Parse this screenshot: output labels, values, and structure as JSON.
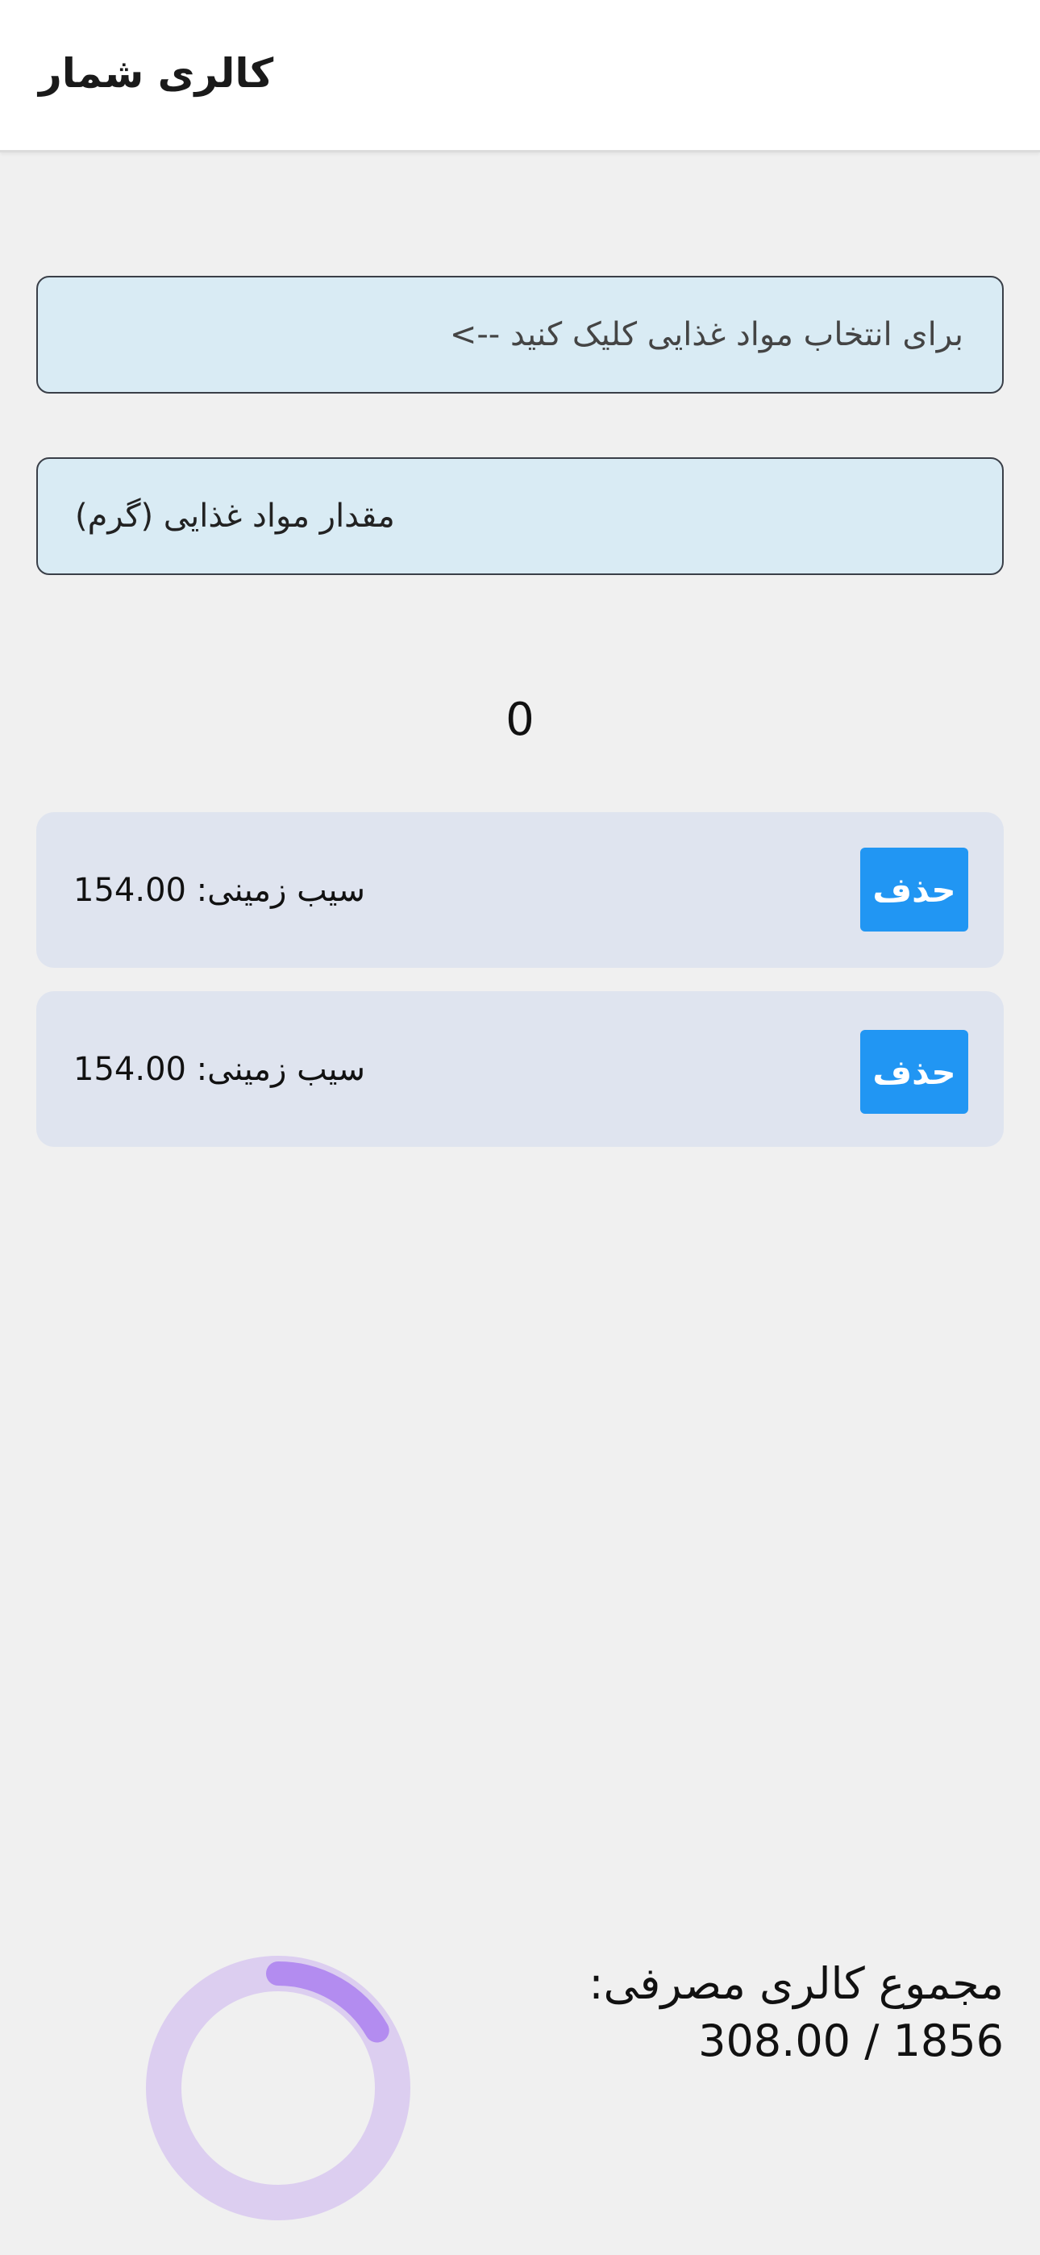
{
  "appbar": {
    "title": "کالری شمار"
  },
  "form": {
    "food_select_text": "برای انتخاب مواد غذایی کلیک کنید -->",
    "amount_placeholder": "مقدار مواد غذایی (گرم)"
  },
  "counter": "0",
  "items": [
    {
      "label": "سیب زمینی: 154.00",
      "delete_label": "حذف"
    },
    {
      "label": "سیب زمینی: 154.00",
      "delete_label": "حذف"
    }
  ],
  "summary": {
    "label": "مجموع کالری مصرفی:",
    "value": "308.00 / 1856",
    "consumed": 308,
    "goal": 1856
  },
  "colors": {
    "accent": "#2196f3",
    "ring_track": "#dccef0",
    "ring_progress": "#b38cf0",
    "field_bg": "#d9ebf4",
    "item_bg": "#dfe4ef"
  }
}
